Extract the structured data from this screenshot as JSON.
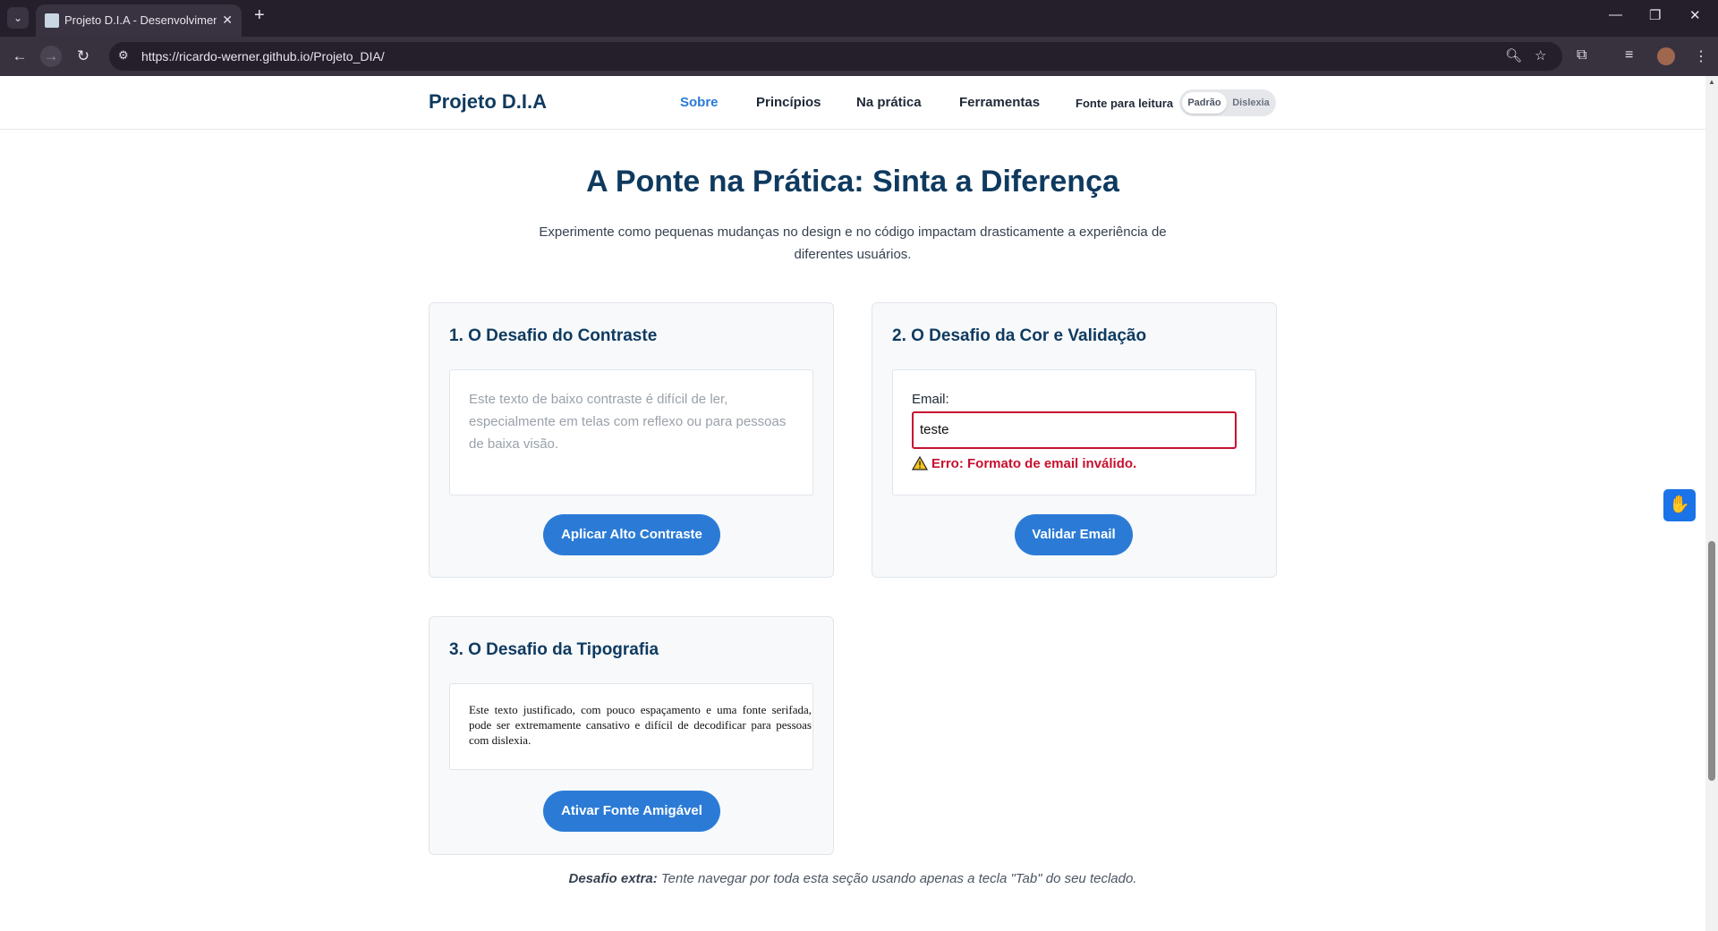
{
  "browser": {
    "tab_title": "Projeto D.I.A - Desenvolvimento",
    "url": "https://ricardo-werner.github.io/Projeto_DIA/"
  },
  "header": {
    "brand": "Projeto D.I.A",
    "nav": [
      "Sobre",
      "Princípios",
      "Na prática",
      "Ferramentas"
    ],
    "active_nav": "Sobre",
    "font_label": "Fonte para leitura",
    "font_options": [
      "Padrão",
      "Dislexia"
    ],
    "font_selected": "Padrão"
  },
  "section": {
    "title": "A Ponte na Prática: Sinta a Diferença",
    "subtitle": "Experimente como pequenas mudanças no design e no código impactam drasticamente a experiência de diferentes usuários."
  },
  "cards": [
    {
      "title": "1. O Desafio do Contraste",
      "text": "Este texto de baixo contraste é difícil de ler, especialmente em telas com reflexo ou para pessoas de baixa visão.",
      "button": "Aplicar Alto Contraste"
    },
    {
      "title": "2. O Desafio da Cor e Validação",
      "field_label": "Email:",
      "field_value": "teste",
      "error": "Erro: Formato de email inválido.",
      "button": "Validar Email"
    },
    {
      "title": "3. O Desafio da Tipografia",
      "text": "Este texto justificado, com pouco espaçamento e uma fonte serifada, pode ser extremamente cansativo e difícil de decodificar para pessoas com dislexia.",
      "button": "Ativar Fonte Amigável"
    }
  ],
  "footnote": {
    "label": "Desafio extra:",
    "text": " Tente navegar por toda esta seção usando apenas a tecla \"Tab\" do seu teclado."
  },
  "colors": {
    "primary": "#2b7bd6",
    "heading": "#0f3a5f",
    "error": "#c8102e"
  }
}
